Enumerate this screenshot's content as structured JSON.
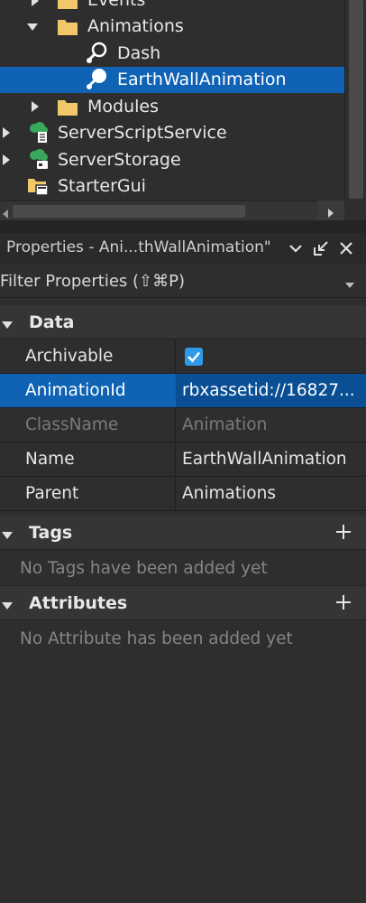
{
  "explorer": {
    "rows": [
      {
        "label": "Events",
        "icon": "folder-icon",
        "expanded": false
      },
      {
        "label": "Animations",
        "icon": "folder-icon",
        "expanded": true
      },
      {
        "label": "Dash",
        "icon": "animation-icon"
      },
      {
        "label": "EarthWallAnimation",
        "icon": "animation-icon",
        "selected": true
      },
      {
        "label": "Modules",
        "icon": "folder-icon",
        "expanded": false
      },
      {
        "label": "ServerScriptService",
        "icon": "server-script-service-icon",
        "expanded": false
      },
      {
        "label": "ServerStorage",
        "icon": "server-storage-icon",
        "expanded": false
      },
      {
        "label": "StarterGui",
        "icon": "starter-gui-icon"
      }
    ]
  },
  "properties": {
    "title": "Properties - Ani...thWallAnimation\"",
    "filter_placeholder": "Filter Properties (⇧⌘P)",
    "sections": {
      "data": {
        "label": "Data",
        "expanded": true
      },
      "tags": {
        "label": "Tags",
        "expanded": true,
        "empty_text": "No Tags have been added yet"
      },
      "attributes": {
        "label": "Attributes",
        "expanded": true,
        "empty_text": "No Attribute has been added yet"
      }
    },
    "rows": [
      {
        "name": "Archivable",
        "value": "",
        "checked": true
      },
      {
        "name": "AnimationId",
        "value": "rbxassetid://16827...",
        "selected": true
      },
      {
        "name": "ClassName",
        "value": "Animation",
        "readonly": true
      },
      {
        "name": "Name",
        "value": "EarthWallAnimation"
      },
      {
        "name": "Parent",
        "value": "Animations"
      }
    ]
  },
  "colors": {
    "background": "#2e2e2e",
    "selection": "#0f62b4",
    "checkbox": "#2e9ae8",
    "folder": "#f0c869",
    "service_green": "#3aa85c"
  }
}
